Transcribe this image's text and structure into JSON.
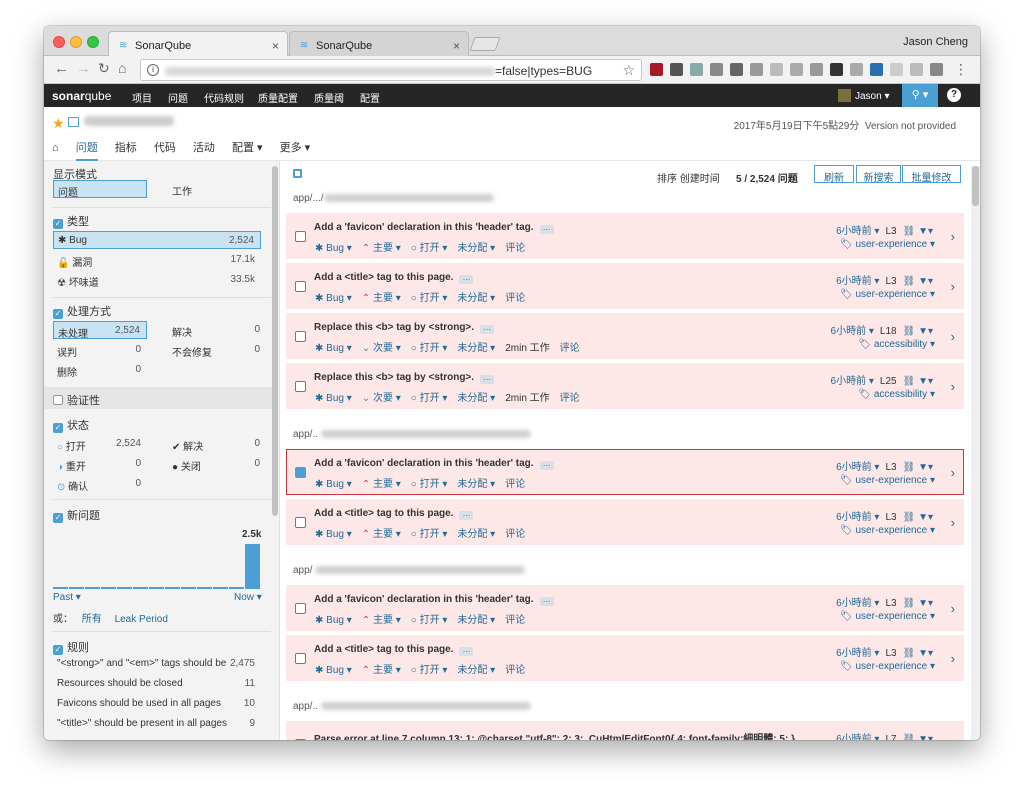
{
  "browser": {
    "tabs": [
      {
        "label": "SonarQube"
      },
      {
        "label": "SonarQube"
      }
    ],
    "user": "Jason Cheng",
    "url_suffix": "=false|types=BUG"
  },
  "nav": {
    "logo_main": "sonar",
    "logo_accent": "qube",
    "menu": [
      "项目",
      "问题",
      "代码规则",
      "质量配置",
      "质量阈",
      "配置"
    ],
    "user": "Jason"
  },
  "project": {
    "date": "2017年5月19日下午5點29分",
    "version": "Version not provided",
    "tabs": [
      "问题",
      "指标",
      "代码",
      "活动",
      "配置",
      "更多"
    ]
  },
  "sidebar": {
    "display_mode": {
      "title": "显示模式",
      "options": [
        "问题",
        "工作"
      ]
    },
    "type": {
      "title": "类型",
      "items": [
        {
          "label": "Bug",
          "count": "2,524"
        },
        {
          "label": "漏洞",
          "count": "17.1k"
        },
        {
          "label": "坏味道",
          "count": "33.5k"
        }
      ]
    },
    "resolution": {
      "title": "处理方式",
      "items": [
        {
          "label": "未处理",
          "count": "2,524"
        },
        {
          "label": "解决",
          "count": "0"
        },
        {
          "label": "误判",
          "count": "0"
        },
        {
          "label": "不会修复",
          "count": "0"
        },
        {
          "label": "删除",
          "count": "0"
        }
      ]
    },
    "verify": {
      "title": "验证性"
    },
    "status": {
      "title": "状态",
      "items": [
        {
          "label": "打开",
          "count": "2,524"
        },
        {
          "label": "解决",
          "count": "0"
        },
        {
          "label": "重开",
          "count": "0"
        },
        {
          "label": "关闭",
          "count": "0"
        },
        {
          "label": "确认",
          "count": "0"
        }
      ]
    },
    "new_issues": {
      "title": "新问题",
      "max_label": "2.5k",
      "past": "Past",
      "now": "Now",
      "or": "或：",
      "all": "所有",
      "leak": "Leak Period"
    },
    "rules": {
      "title": "规则",
      "items": [
        {
          "label": "\"<strong>\" and \"<em>\" tags should be",
          "count": "2,475"
        },
        {
          "label": "Resources should be closed",
          "count": "11"
        },
        {
          "label": "Favicons should be used in all pages",
          "count": "10"
        },
        {
          "label": "\"<title>\" should be present in all pages",
          "count": "9"
        }
      ]
    }
  },
  "main": {
    "sort_label": "排序 创建时间",
    "count": "5 / 2,524 问题",
    "buttons": [
      "刷新",
      "新搜索",
      "批量修改"
    ],
    "path_prefix": "app/",
    "issues": [
      {
        "msg": "Add a 'favicon' declaration in this 'header' tag.",
        "sev": "主要",
        "status": "打开",
        "assignee": "未分配",
        "effort": "",
        "comment": "评论",
        "time": "6小時前",
        "line": "L3",
        "tag": "user-experience"
      },
      {
        "msg": "Add a <title> tag to this page.",
        "sev": "主要",
        "status": "打开",
        "assignee": "未分配",
        "effort": "",
        "comment": "评论",
        "time": "6小時前",
        "line": "L3",
        "tag": "user-experience"
      },
      {
        "msg": "Replace this <b> tag by <strong>.",
        "sev": "次要",
        "status": "打开",
        "assignee": "未分配",
        "effort": "2min 工作",
        "comment": "评论",
        "time": "6小時前",
        "line": "L18",
        "tag": "accessibility"
      },
      {
        "msg": "Replace this <b> tag by <strong>.",
        "sev": "次要",
        "status": "打开",
        "assignee": "未分配",
        "effort": "2min 工作",
        "comment": "评论",
        "time": "6小時前",
        "line": "L25",
        "tag": "accessibility"
      },
      {
        "msg": "Add a 'favicon' declaration in this 'header' tag.",
        "sev": "主要",
        "status": "打开",
        "assignee": "未分配",
        "effort": "",
        "comment": "评论",
        "time": "6小時前",
        "line": "L3",
        "tag": "user-experience"
      },
      {
        "msg": "Add a <title> tag to this page.",
        "sev": "主要",
        "status": "打开",
        "assignee": "未分配",
        "effort": "",
        "comment": "评论",
        "time": "6小時前",
        "line": "L3",
        "tag": "user-experience"
      },
      {
        "msg": "Add a 'favicon' declaration in this 'header' tag.",
        "sev": "主要",
        "status": "打开",
        "assignee": "未分配",
        "effort": "",
        "comment": "评论",
        "time": "6小時前",
        "line": "L3",
        "tag": "user-experience"
      },
      {
        "msg": "Add a <title> tag to this page.",
        "sev": "主要",
        "status": "打开",
        "assignee": "未分配",
        "effort": "",
        "comment": "评论",
        "time": "6小時前",
        "line": "L3",
        "tag": "user-experience"
      },
      {
        "msg": "Parse error at line 7 column 13: 1: @charset \"utf-8\"; 2: 3: .CuHtmlEditFont0{ 4: font-family:細明體; 5: }",
        "sev": "",
        "status": "",
        "assignee": "",
        "effort": "",
        "comment": "",
        "time": "6小時前",
        "line": "L7",
        "tag": ""
      }
    ],
    "label_bug": "Bug"
  },
  "colors": {
    "accent": "#4b9fd5",
    "nav_bg": "#262626",
    "issue_bg": "#fde7e7",
    "major": "#d4333f",
    "minor": "#3e9e3e"
  }
}
